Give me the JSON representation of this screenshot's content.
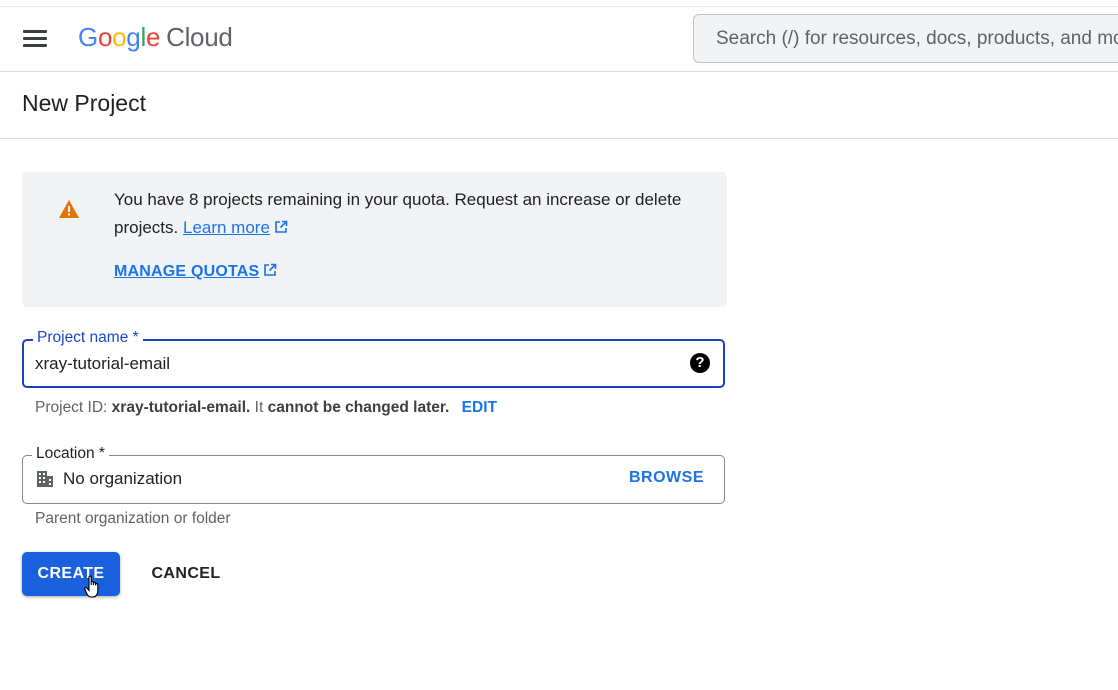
{
  "header": {
    "logo": {
      "letters": [
        "G",
        "o",
        "o",
        "g",
        "l",
        "e"
      ],
      "product": "Cloud"
    },
    "search_placeholder": "Search (/) for resources, docs, products, and more"
  },
  "page": {
    "title": "New Project"
  },
  "quota_banner": {
    "message": "You have 8 projects remaining in your quota. Request an increase or delete projects.",
    "learn_more": "Learn more",
    "manage_quotas": "MANAGE QUOTAS",
    "icon": "warning-icon"
  },
  "project_name": {
    "label": "Project name *",
    "value": "xray-tutorial-email",
    "help_icon": "help-icon"
  },
  "project_id_hint": {
    "prefix": "Project ID:",
    "id": "xray-tutorial-email.",
    "middle": "It",
    "emphasis": "cannot be changed later.",
    "edit": "EDIT"
  },
  "location": {
    "label": "Location *",
    "value": "No organization",
    "browse": "BROWSE",
    "hint": "Parent organization or folder",
    "icon": "building-icon"
  },
  "actions": {
    "create": "CREATE",
    "cancel": "CANCEL"
  },
  "colors": {
    "primary": "#1a73e8",
    "focus_border": "#1a3fb8",
    "warning": "#e37400"
  }
}
